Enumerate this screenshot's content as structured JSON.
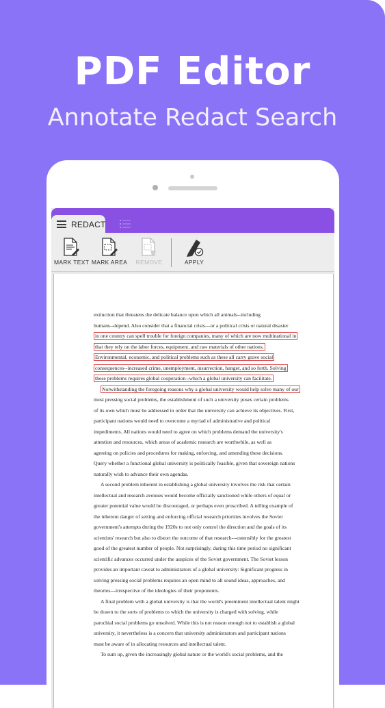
{
  "promo": {
    "title": "PDF Editor",
    "subtitle": "Annotate Redact Search"
  },
  "colors": {
    "background": "#8a73f6",
    "tabbar": "#8a4fe3",
    "toolbar": "#ededee",
    "redact_mark": "#e05050"
  },
  "tabs": {
    "active": {
      "label": "REDACT",
      "icon": "hamburger-menu-icon"
    },
    "other": {
      "icon": "list-icon"
    }
  },
  "toolbar": {
    "mark_text": {
      "label": "MARK TEXT",
      "icon": "mark-text-icon"
    },
    "mark_area": {
      "label": "MARK AREA",
      "icon": "mark-area-icon"
    },
    "remove": {
      "label": "REMOVE",
      "icon": "remove-icon"
    },
    "apply": {
      "label": "APPLY",
      "icon": "apply-marker-icon"
    }
  },
  "document": {
    "lines": [
      {
        "text": "extinction that threatens the delicate balance upon which all animals--including",
        "mark": false,
        "indent": false
      },
      {
        "text": "humans--depend. Also consider that a financial crisis---or a political crisis or natural disaster",
        "mark": false,
        "indent": false
      },
      {
        "text": "in one country can spell trouble for foreign companies, many of which are now multinational in",
        "mark": true,
        "indent": false
      },
      {
        "text": "that they rely on the labor forces, equipment, and raw materials of other nations.",
        "mark": true,
        "indent": false
      },
      {
        "text": "Environmental, economic, and political problems such as these all carry grave social",
        "mark": true,
        "indent": false
      },
      {
        "text": "consequences--increased crime, unemployment, insurrection, hunger, and so forth. Solving",
        "mark": true,
        "indent": false
      },
      {
        "text": "these problems requires global cooperation--which a        global university can facilitate.",
        "mark": true,
        "indent": false
      },
      {
        "text": "Notwithstanding the foregoing reasons why a global university would help solve many of our",
        "mark": true,
        "indent": true
      },
      {
        "text": "most pressing social problems, the establishment of such a university poses certain problems",
        "mark": false,
        "indent": false
      },
      {
        "text": "of its own which must be addressed in order that the university can achieve its objectives. First,",
        "mark": false,
        "indent": false
      },
      {
        "text": "participant nations would need to overcome a myriad of administrative and political",
        "mark": false,
        "indent": false
      },
      {
        "text": "impediments. All nations would need to agree on which problems demand the university's",
        "mark": false,
        "indent": false
      },
      {
        "text": "attention and resources, which areas of academic research are worthwhile, as well as",
        "mark": false,
        "indent": false
      },
      {
        "text": "agreeing on policies and procedures for making, enforcing, and amending these decisions.",
        "mark": false,
        "indent": false
      },
      {
        "text": "Query whether a functional global university is politically feasible, given that sovereign nations",
        "mark": false,
        "indent": false
      },
      {
        "text": "naturally wish to advance their own agendas.",
        "mark": false,
        "indent": false
      },
      {
        "text": "A second problem inherent in establishing a global university involves the risk that certain",
        "mark": false,
        "indent": true
      },
      {
        "text": "intellectual and research avenues would become officially sanctioned while others of equal or",
        "mark": false,
        "indent": false
      },
      {
        "text": "greater potential value would be discouraged, or perhaps even proscribed. A telling example of",
        "mark": false,
        "indent": false
      },
      {
        "text": "the inherent danger of setting and enforcing official research priorities involves the Soviet",
        "mark": false,
        "indent": false
      },
      {
        "text": "government's attempts during the 1920s to not only control the direction and the goals of its",
        "mark": false,
        "indent": false
      },
      {
        "text": "scientists' research but also to distort the outcome of that research---ostensibly for the greatest",
        "mark": false,
        "indent": false
      },
      {
        "text": "good of the greatest number of people. Not surprisingly, during this time period no significant",
        "mark": false,
        "indent": false
      },
      {
        "text": "scientific advances occurred under the auspices of the Soviet government. The Soviet lesson",
        "mark": false,
        "indent": false
      },
      {
        "text": "provides an important caveat to administrators of a global university: Significant progress in",
        "mark": false,
        "indent": false
      },
      {
        "text": "solving pressing social problems requires an open mind to all sound ideas, approaches, and",
        "mark": false,
        "indent": false
      },
      {
        "text": "theories---irrespective of the ideologies of their proponents.",
        "mark": false,
        "indent": false
      },
      {
        "text": "A final problem with a global university is that the world's preeminent intellectual talent might",
        "mark": false,
        "indent": true
      },
      {
        "text": "be drawn to the sorts of problems to which the university is charged with solving, while",
        "mark": false,
        "indent": false
      },
      {
        "text": "parochial social problems go unsolved. While this is not reason enough not to establish a global",
        "mark": false,
        "indent": false
      },
      {
        "text": "university, it nevertheless is a concern that university administrators and participant nations",
        "mark": false,
        "indent": false
      },
      {
        "text": "must be aware of in allocating resources and intellectual talent.",
        "mark": false,
        "indent": false
      },
      {
        "text": "To sum up, given the increasingly global nature or the world's social problems, and the",
        "mark": false,
        "indent": true
      }
    ]
  }
}
